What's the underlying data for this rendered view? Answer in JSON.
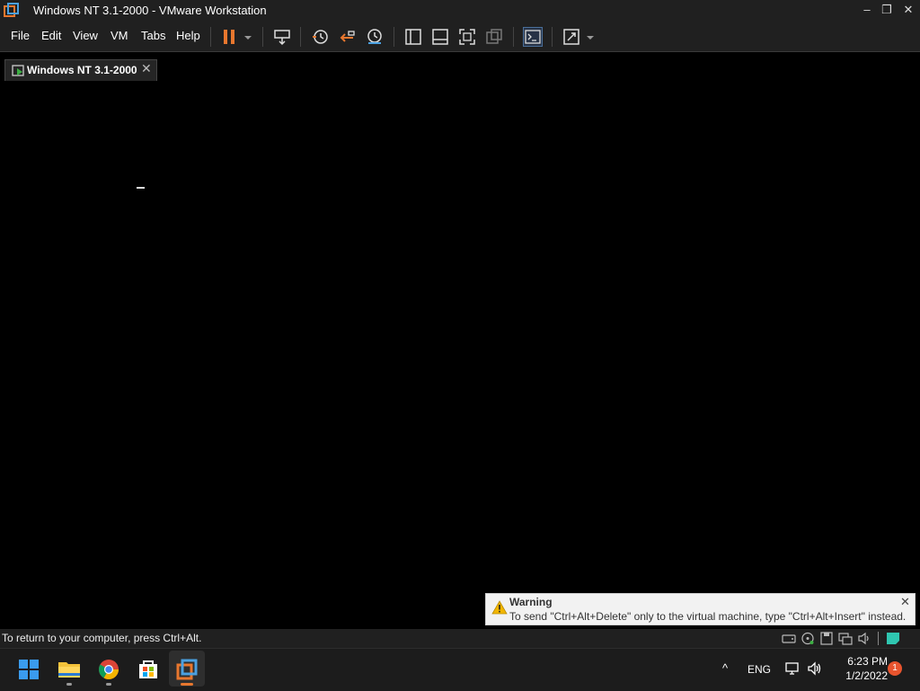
{
  "window": {
    "title": "Windows NT 3.1-2000 - VMware Workstation",
    "minimize": "–",
    "maximize": "❐",
    "close": "✕"
  },
  "menu": [
    "File",
    "Edit",
    "View",
    "VM",
    "Tabs",
    "Help"
  ],
  "toolbar_icons": [
    "pause-icon",
    "send-ctrl-alt-del-icon",
    "snapshot-icon",
    "revert-snapshot-icon",
    "snapshot-manager-icon",
    "show-library-icon",
    "thumbnail-bar-icon",
    "full-screen-icon",
    "unity-icon",
    "console-view-icon",
    "stretch-icon"
  ],
  "tab": {
    "label": "Windows NT 3.1-2000",
    "close": "✕"
  },
  "warning": {
    "title": "Warning",
    "text": "To send \"Ctrl+Alt+Delete\" only to the virtual machine, type \"Ctrl+Alt+Insert\" instead.",
    "close": "✕"
  },
  "status": {
    "text": "To return to your computer, press Ctrl+Alt."
  },
  "status_icons": [
    "hard-disk-icon",
    "cd-dvd-icon",
    "floppy-icon",
    "network-adapter-icon",
    "sound-card-icon",
    "message-log-icon"
  ],
  "taskbar": {
    "apps": [
      "start-icon",
      "file-explorer-icon",
      "chrome-icon",
      "store-icon",
      "vmware-icon"
    ],
    "tray_chevron": "^",
    "language": "ENG",
    "time": "6:23 PM",
    "date": "1/2/2022",
    "notifications": "1"
  },
  "colors": {
    "accent_orange": "#e8772e",
    "titlebar": "#202020",
    "toast_bg": "#f2f2f2",
    "warning_yellow": "#f2b600"
  }
}
